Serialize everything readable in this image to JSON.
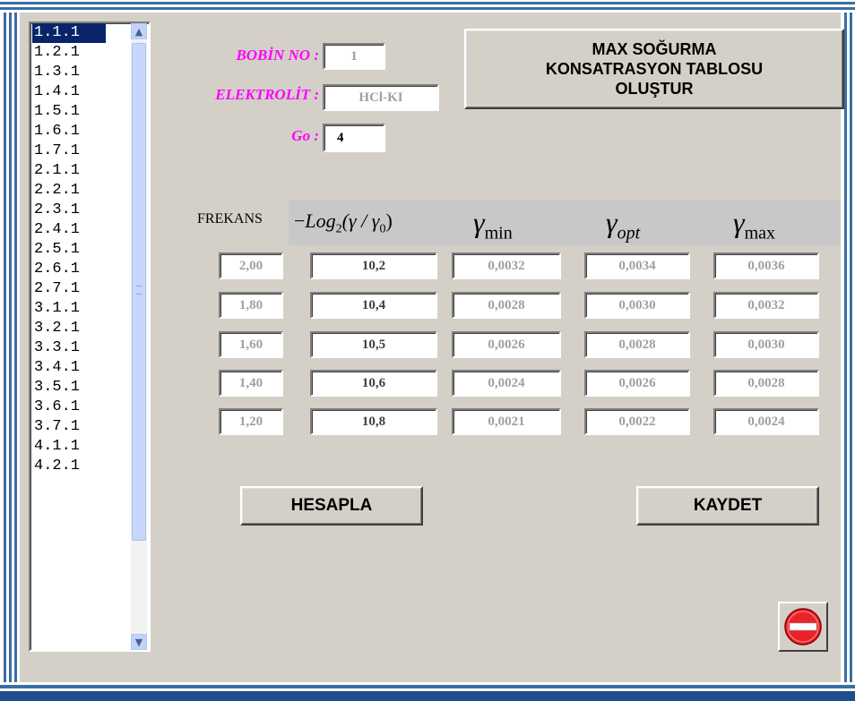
{
  "list": {
    "items": [
      "1.1.1",
      "1.2.1",
      "1.3.1",
      "1.4.1",
      "1.5.1",
      "1.6.1",
      "1.7.1",
      "2.1.1",
      "2.2.1",
      "2.3.1",
      "2.4.1",
      "2.5.1",
      "2.6.1",
      "2.7.1",
      "3.1.1",
      "3.2.1",
      "3.3.1",
      "3.4.1",
      "3.5.1",
      "3.6.1",
      "3.7.1",
      "4.1.1",
      "4.2.1"
    ],
    "selected": "1.1.1",
    "up_arrow": "▲",
    "down_arrow": "▼"
  },
  "fields": {
    "bobin_label": "BOBİN NO :",
    "bobin_value": "1",
    "elektrolit_label": "ELEKTROLİT :",
    "elektrolit_value": "HCl-KI",
    "go_label": "Go :",
    "go_value": "4"
  },
  "buttons": {
    "max_line1": "MAX SOĞURMA",
    "max_line2": "KONSATRASYON TABLOSU",
    "max_line3": "OLUŞTUR",
    "hesapla": "HESAPLA",
    "kaydet": "KAYDET"
  },
  "table": {
    "freq_header": "FREKANS",
    "log_header_minus": "−",
    "log_header_text": "Log",
    "log_header_sub": "2",
    "log_header_args": "(γ / γ",
    "log_header_sub0": "0",
    "log_header_close": ")",
    "ymin_sub": "min",
    "yopt_sub": "opt",
    "ymax_sub": "max",
    "gamma": "γ",
    "rows": [
      {
        "freq": "2,00",
        "log": "10,2",
        "min": "0,0032",
        "opt": "0,0034",
        "max": "0,0036"
      },
      {
        "freq": "1,80",
        "log": "10,4",
        "min": "0,0028",
        "opt": "0,0030",
        "max": "0,0032"
      },
      {
        "freq": "1,60",
        "log": "10,5",
        "min": "0,0026",
        "opt": "0,0028",
        "max": "0,0030"
      },
      {
        "freq": "1,40",
        "log": "10,6",
        "min": "0,0024",
        "opt": "0,0026",
        "max": "0,0028"
      },
      {
        "freq": "1,20",
        "log": "10,8",
        "min": "0,0021",
        "opt": "0,0022",
        "max": "0,0024"
      }
    ]
  },
  "colors": {
    "label_magenta": "#ff00ff",
    "frame_blue": "#3a6ea5",
    "stop_red": "#e8242a"
  }
}
